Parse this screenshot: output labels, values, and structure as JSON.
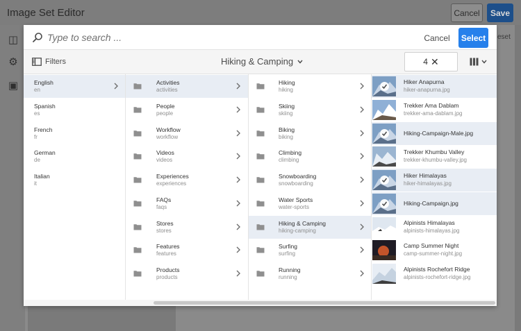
{
  "editor": {
    "title": "Image Set Editor",
    "cancel_label": "Cancel",
    "save_label": "Save",
    "reset_label": "eset"
  },
  "dialog": {
    "search_placeholder": "Type to search ...",
    "cancel_label": "Cancel",
    "select_label": "Select",
    "filters_label": "Filters",
    "breadcrumb": "Hiking & Camping",
    "selection_count": "4"
  },
  "columns": {
    "languages": [
      {
        "title": "English",
        "sub": "en",
        "selected": true,
        "has_children": true
      },
      {
        "title": "Spanish",
        "sub": "es"
      },
      {
        "title": "French",
        "sub": "fr"
      },
      {
        "title": "German",
        "sub": "de"
      },
      {
        "title": "Italian",
        "sub": "it"
      }
    ],
    "sections": [
      {
        "title": "Activities",
        "sub": "activities",
        "selected": true
      },
      {
        "title": "People",
        "sub": "people"
      },
      {
        "title": "Workflow",
        "sub": "workflow"
      },
      {
        "title": "Videos",
        "sub": "videos"
      },
      {
        "title": "Experiences",
        "sub": "experiences"
      },
      {
        "title": "FAQs",
        "sub": "faqs"
      },
      {
        "title": "Stores",
        "sub": "stores"
      },
      {
        "title": "Features",
        "sub": "features"
      },
      {
        "title": "Products",
        "sub": "products"
      }
    ],
    "activities": [
      {
        "title": "Hiking",
        "sub": "hiking"
      },
      {
        "title": "Skiing",
        "sub": "skiing"
      },
      {
        "title": "Biking",
        "sub": "biking"
      },
      {
        "title": "Climbing",
        "sub": "climbing"
      },
      {
        "title": "Snowboarding",
        "sub": "snowboarding"
      },
      {
        "title": "Water Sports",
        "sub": "water-sports"
      },
      {
        "title": "Hiking & Camping",
        "sub": "hiking-camping",
        "selected": true
      },
      {
        "title": "Surfing",
        "sub": "surfing"
      },
      {
        "title": "Running",
        "sub": "running"
      }
    ],
    "assets": [
      {
        "title": "Hiker Anapurna",
        "sub": "hiker-anapurna.jpg",
        "checked": true,
        "thumb": "mountain-blue"
      },
      {
        "title": "Trekker Ama Dablam",
        "sub": "trekker-ama-dablam.jpg",
        "checked": false,
        "thumb": "mountain-snow"
      },
      {
        "title": "Hiking-Campaign-Male.jpg",
        "sub": "",
        "checked": true,
        "thumb": "mountain-blue"
      },
      {
        "title": "Trekker Khumbu Valley",
        "sub": "trekker-khumbu-valley.jpg",
        "checked": false,
        "thumb": "valley"
      },
      {
        "title": "Hiker Himalayas",
        "sub": "hiker-himalayas.jpg",
        "checked": true,
        "thumb": "mountain-blue"
      },
      {
        "title": "Hiking-Campaign.jpg",
        "sub": "",
        "checked": true,
        "thumb": "mountain-blue"
      },
      {
        "title": "Alpinists Himalayas",
        "sub": "alpinists-himalayas.jpg",
        "checked": false,
        "thumb": "snow-ridge"
      },
      {
        "title": "Camp Summer Night",
        "sub": "camp-summer-night.jpg",
        "checked": false,
        "thumb": "night"
      },
      {
        "title": "Alpinists Rochefort Ridge",
        "sub": "alpinists-rochefort-ridge.jpg",
        "checked": false,
        "thumb": "ridge"
      }
    ]
  },
  "colors": {
    "accent": "#2680eb",
    "selected_row": "#e8edf4"
  }
}
